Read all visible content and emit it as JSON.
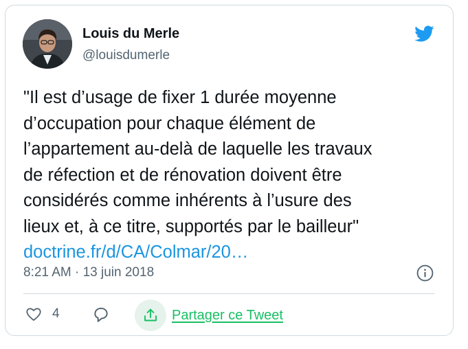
{
  "tweet": {
    "author_name": "Louis du Merle",
    "author_handle": "@louisdumerle",
    "text_lines": [
      "\"Il est d’usage de fixer 1 durée moyenne",
      "d’occupation pour chaque élément de",
      "l’appartement au-delà de laquelle les travaux",
      "de réfection et de rénovation doivent être",
      "considérés comme inhérents à l’usure des",
      "lieux et, à ce titre, supportés par le bailleur\""
    ],
    "link_text": "doctrine.fr/d/CA/Colmar/20…",
    "timestamp": "8:21 AM · 13 juin 2018"
  },
  "actions": {
    "like_count": "4",
    "share_label": "Partager ce Tweet"
  },
  "colors": {
    "twitter_blue": "#1d9bf0",
    "link_blue": "#1b95e0",
    "share_green": "#17bf63",
    "muted_gray": "#536471",
    "border": "#cfd9de"
  },
  "icons": {
    "brand": "twitter-bird-icon",
    "info": "info-icon",
    "like": "heart-icon",
    "reply": "reply-bubble-icon",
    "share": "share-upload-icon"
  }
}
